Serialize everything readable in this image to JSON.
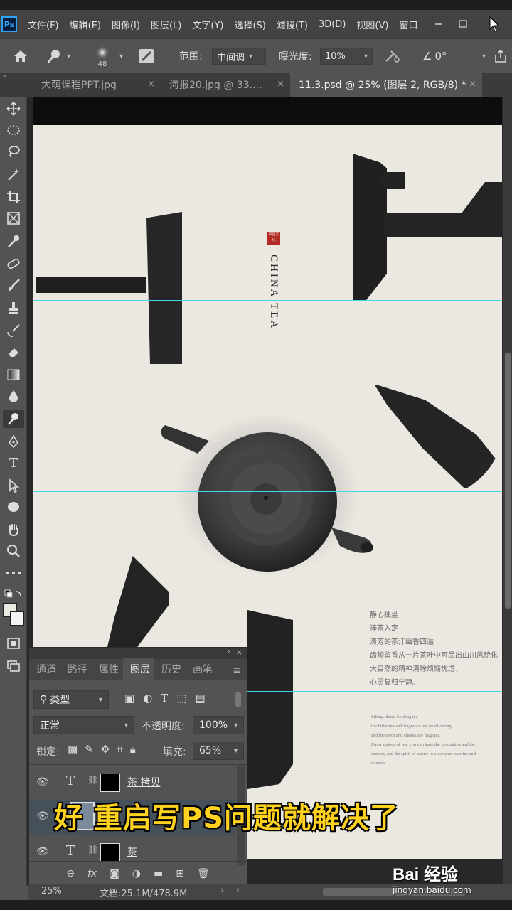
{
  "app": {
    "logo": "Ps"
  },
  "menu": [
    "文件(F)",
    "编辑(E)",
    "图像(I)",
    "图层(L)",
    "文字(Y)",
    "选择(S)",
    "滤镜(T)",
    "3D(D)",
    "视图(V)",
    "窗口"
  ],
  "options": {
    "brush_size": "48",
    "range_label": "范围:",
    "range_value": "中间调",
    "exposure_label": "曝光度:",
    "exposure_value": "10%",
    "angle_value": "0°"
  },
  "tabs": [
    {
      "label": "大萌课程PPT.jpg",
      "close": "×"
    },
    {
      "label": "海报20.jpg @ 33....",
      "close": "×"
    },
    {
      "label": "11.3.psd @ 25% (图层 2, RGB/8) *",
      "close": "×"
    }
  ],
  "poster": {
    "seal": "中国文化",
    "vertical_title": "CHINA TEA",
    "cn_lines": [
      "静心独坐",
      "捧茶入定",
      "清芳的茶汗幽香四溢",
      "齿颊留香从一片茶叶中可品出山川风貌化",
      "大自然的精神清除烦恼忧虑，",
      "心灵复归宁静。"
    ],
    "en_lines": [
      "Sitting alone, holding tea",
      "the bitter tea and fragrance are overflowing,",
      "and the teeth and cheeks are fragrant.",
      "From a piece of tea, you can taste the mountains and the",
      "scenery and the spirit of nature to clear your worries and",
      "worries."
    ]
  },
  "layers_panel": {
    "tabs": [
      "通道",
      "路径",
      "属性",
      "图层",
      "历史",
      "画笔"
    ],
    "filter_label": "类型",
    "blend_mode": "正常",
    "opacity_label": "不透明度:",
    "opacity_value": "100%",
    "lock_label": "锁定:",
    "fill_label": "填充:",
    "fill_value": "65%",
    "layers": [
      {
        "name": "茶 拷贝",
        "type_icon": "T"
      },
      {
        "name": "",
        "type_icon": ""
      },
      {
        "name": "茶",
        "type_icon": "T"
      }
    ]
  },
  "status": {
    "zoom": "25%",
    "doc_info": "文档:25.1M/478.9M"
  },
  "caption": "好 重启写PS问题就解决了",
  "watermark": {
    "brand": "Bai  经验",
    "url": "jingyan.baidu.com"
  }
}
